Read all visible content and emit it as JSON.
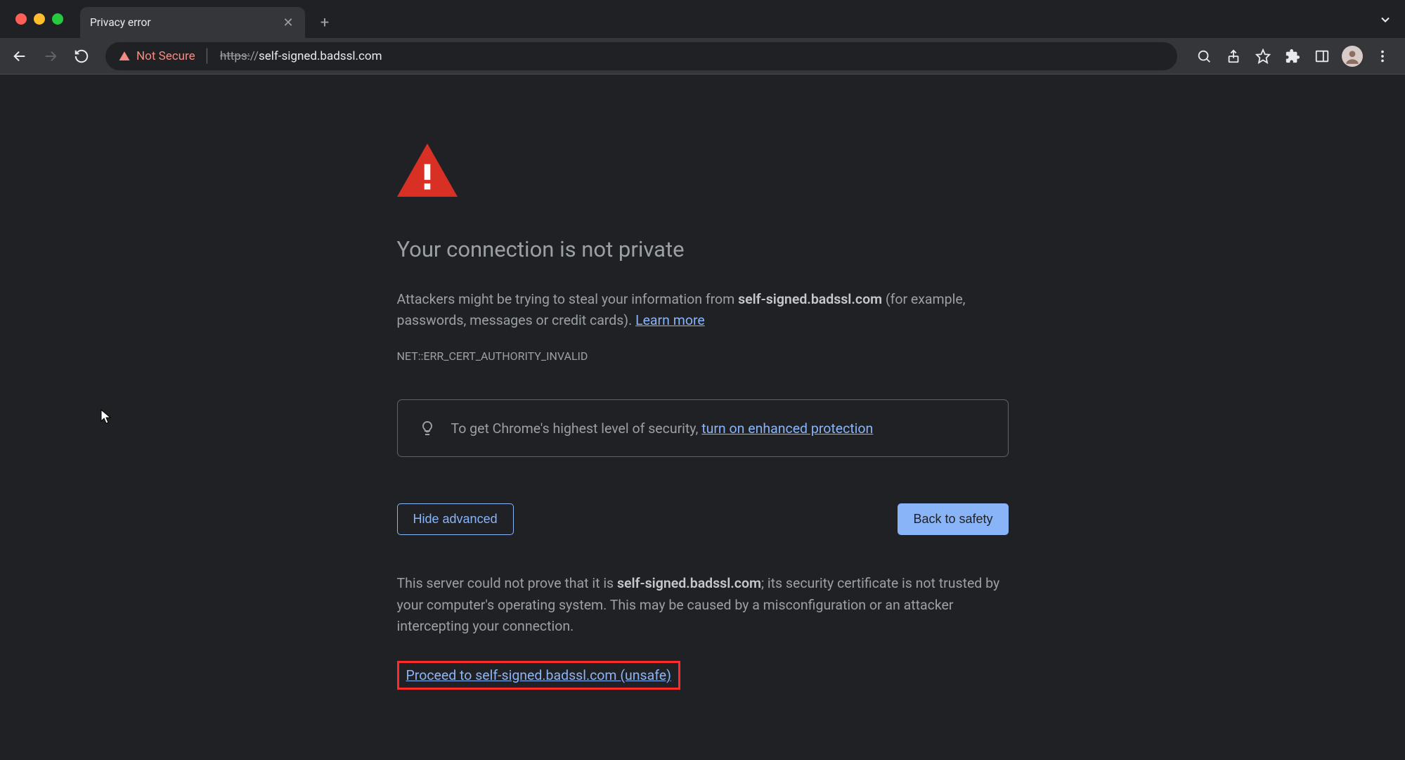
{
  "tab": {
    "title": "Privacy error"
  },
  "omnibox": {
    "insecure_label": "Not Secure",
    "url_scheme": "https:",
    "url_sep": "//",
    "url_host": "self-signed.badssl.com"
  },
  "interstitial": {
    "title": "Your connection is not private",
    "body_prefix": "Attackers might be trying to steal your information from ",
    "body_host": "self-signed.badssl.com",
    "body_suffix": " (for example, passwords, messages or credit cards). ",
    "learn_more": "Learn more",
    "error_code": "NET::ERR_CERT_AUTHORITY_INVALID",
    "tip_prefix": "To get Chrome's highest level of security, ",
    "tip_link": "turn on enhanced protection",
    "hide_advanced": "Hide advanced",
    "back_to_safety": "Back to safety",
    "advanced_prefix": "This server could not prove that it is ",
    "advanced_host": "self-signed.badssl.com",
    "advanced_suffix": "; its security certificate is not trusted by your computer's operating system. This may be caused by a misconfiguration or an attacker intercepting your connection.",
    "proceed_label": "Proceed to self-signed.badssl.com (unsafe)"
  }
}
